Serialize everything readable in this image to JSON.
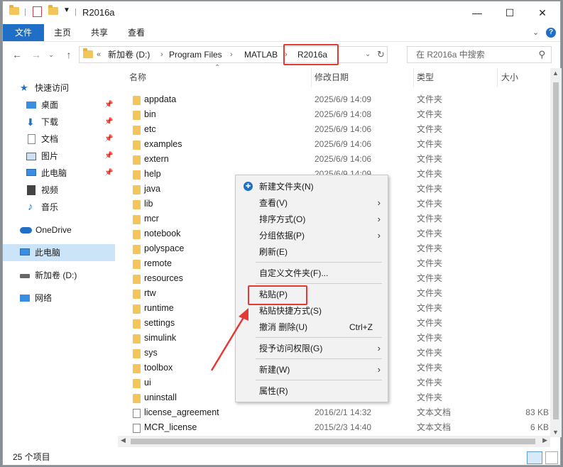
{
  "window": {
    "title": "R2016a",
    "controls": [
      "—",
      "☐",
      "✕"
    ]
  },
  "ribbon": {
    "tabs": [
      {
        "label": "文件",
        "active": true
      },
      {
        "label": "主页",
        "active": false
      },
      {
        "label": "共享",
        "active": false
      },
      {
        "label": "查看",
        "active": false
      }
    ]
  },
  "address": {
    "prefix": "«",
    "crumbs": [
      "新加卷 (D:)",
      "Program Files",
      "MATLAB",
      "R2016a"
    ],
    "search_placeholder": "在 R2016a 中搜索"
  },
  "sidebar": {
    "items": [
      {
        "label": "快速访问",
        "icon": "star-icon",
        "pinned": false
      },
      {
        "label": "桌面",
        "icon": "desktop-icon",
        "pinned": true
      },
      {
        "label": "下载",
        "icon": "download-icon",
        "pinned": true
      },
      {
        "label": "文档",
        "icon": "document-icon",
        "pinned": true
      },
      {
        "label": "图片",
        "icon": "picture-icon",
        "pinned": true
      },
      {
        "label": "此电脑",
        "icon": "computer-icon",
        "pinned": true
      },
      {
        "label": "视频",
        "icon": "video-icon",
        "pinned": false
      },
      {
        "label": "音乐",
        "icon": "music-icon",
        "pinned": false
      },
      {
        "label": "OneDrive",
        "icon": "cloud-icon",
        "pinned": false
      },
      {
        "label": "此电脑",
        "icon": "computer-icon",
        "pinned": false,
        "selected": true
      },
      {
        "label": "新加卷 (D:)",
        "icon": "drive-icon",
        "pinned": false
      },
      {
        "label": "网络",
        "icon": "network-icon",
        "pinned": false
      }
    ]
  },
  "columns": {
    "name": "名称",
    "date": "修改日期",
    "type": "类型",
    "size": "大小"
  },
  "files": [
    {
      "name": "appdata",
      "date": "2025/6/9 14:09",
      "type": "文件夹",
      "size": "",
      "kind": "folder"
    },
    {
      "name": "bin",
      "date": "2025/6/9 14:08",
      "type": "文件夹",
      "size": "",
      "kind": "folder"
    },
    {
      "name": "etc",
      "date": "2025/6/9 14:06",
      "type": "文件夹",
      "size": "",
      "kind": "folder"
    },
    {
      "name": "examples",
      "date": "2025/6/9 14:06",
      "type": "文件夹",
      "size": "",
      "kind": "folder"
    },
    {
      "name": "extern",
      "date": "2025/6/9 14:06",
      "type": "文件夹",
      "size": "",
      "kind": "folder"
    },
    {
      "name": "help",
      "date": "2025/6/9 14:09",
      "type": "文件夹",
      "size": "",
      "kind": "folder"
    },
    {
      "name": "java",
      "date": "",
      "type": "文件夹",
      "size": "",
      "kind": "folder"
    },
    {
      "name": "lib",
      "date": "",
      "type": "文件夹",
      "size": "",
      "kind": "folder"
    },
    {
      "name": "mcr",
      "date": "",
      "type": "文件夹",
      "size": "",
      "kind": "folder"
    },
    {
      "name": "notebook",
      "date": "",
      "type": "文件夹",
      "size": "",
      "kind": "folder"
    },
    {
      "name": "polyspace",
      "date": "",
      "type": "文件夹",
      "size": "",
      "kind": "folder"
    },
    {
      "name": "remote",
      "date": "",
      "type": "文件夹",
      "size": "",
      "kind": "folder"
    },
    {
      "name": "resources",
      "date": "",
      "type": "文件夹",
      "size": "",
      "kind": "folder"
    },
    {
      "name": "rtw",
      "date": "",
      "type": "文件夹",
      "size": "",
      "kind": "folder"
    },
    {
      "name": "runtime",
      "date": "",
      "type": "文件夹",
      "size": "",
      "kind": "folder"
    },
    {
      "name": "settings",
      "date": "",
      "type": "文件夹",
      "size": "",
      "kind": "folder"
    },
    {
      "name": "simulink",
      "date": "",
      "type": "文件夹",
      "size": "",
      "kind": "folder"
    },
    {
      "name": "sys",
      "date": "",
      "type": "文件夹",
      "size": "",
      "kind": "folder"
    },
    {
      "name": "toolbox",
      "date": "",
      "type": "文件夹",
      "size": "",
      "kind": "folder"
    },
    {
      "name": "ui",
      "date": "",
      "type": "文件夹",
      "size": "",
      "kind": "folder"
    },
    {
      "name": "uninstall",
      "date": "",
      "type": "文件夹",
      "size": "",
      "kind": "folder"
    },
    {
      "name": "license_agreement",
      "date": "2016/2/1 14:32",
      "type": "文本文档",
      "size": "83 KB",
      "kind": "doc"
    },
    {
      "name": "MCR_license",
      "date": "2015/2/3 14:40",
      "type": "文本文档",
      "size": "6 KB",
      "kind": "doc"
    }
  ],
  "context_menu": {
    "items": [
      {
        "label": "新建文件夹(N)",
        "icon": "new-folder-icon",
        "submenu": false
      },
      {
        "label": "查看(V)",
        "submenu": true
      },
      {
        "label": "排序方式(O)",
        "submenu": true
      },
      {
        "label": "分组依据(P)",
        "submenu": true
      },
      {
        "label": "刷新(E)",
        "submenu": false
      },
      {
        "label": "自定义文件夹(F)...",
        "submenu": false
      },
      {
        "label": "粘贴(P)",
        "submenu": false,
        "highlighted": true
      },
      {
        "label": "粘贴快捷方式(S)",
        "submenu": false
      },
      {
        "label": "撤消 删除(U)",
        "shortcut": "Ctrl+Z",
        "submenu": false
      },
      {
        "label": "授予访问权限(G)",
        "submenu": true
      },
      {
        "label": "新建(W)",
        "submenu": true
      },
      {
        "label": "属性(R)",
        "submenu": false
      }
    ]
  },
  "status": {
    "count": "25 个项目"
  },
  "colors": {
    "accent": "#1f6fc6",
    "annotation": "#e53935",
    "folder": "#f4c55a"
  }
}
